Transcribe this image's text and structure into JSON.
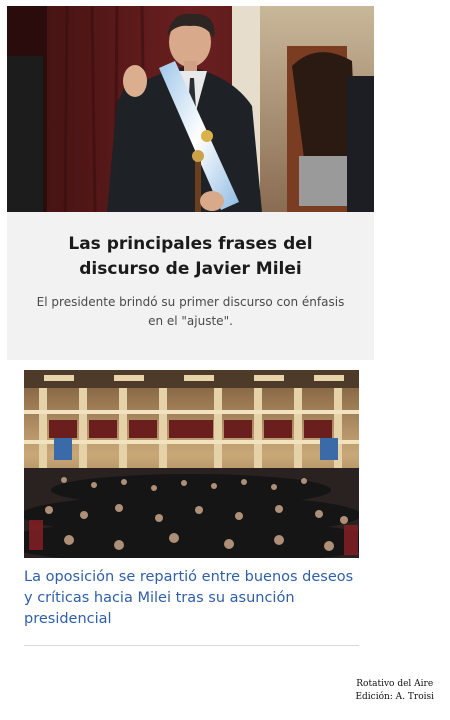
{
  "articles": [
    {
      "headline": "Las principales frases del discurso de Javier Milei",
      "subheadline": "El presidente brindó su primer discurso con énfasis en el \"ajuste\".",
      "image": "photo-president-sash-waving",
      "headline_color": "#1b1b1b"
    },
    {
      "headline": "La oposición se repartió entre buenos deseos y críticas hacia Milei tras su asunción presidencial",
      "image": "photo-congress-chamber",
      "headline_color": "#2f5fa8"
    }
  ],
  "credits": {
    "line1": "Rotativo del Aire",
    "line2": "Edición: A. Troisi"
  }
}
